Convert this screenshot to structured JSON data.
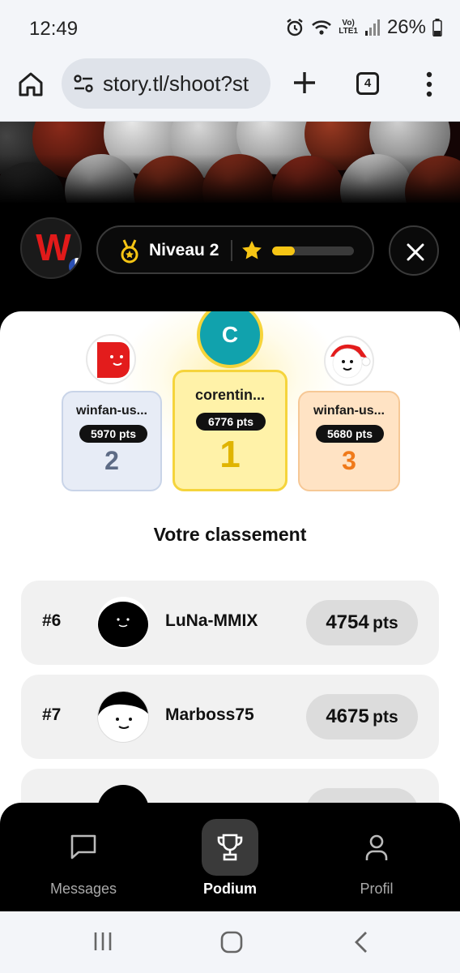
{
  "status_bar": {
    "time": "12:49",
    "network_label": "Vo)",
    "network_sub": "LTE1",
    "battery": "26%"
  },
  "browser": {
    "url": "story.tl/shoot?st",
    "tab_count": "4"
  },
  "header": {
    "level_label": "Niveau 2",
    "level_progress": 0.28,
    "brand_letter": "W"
  },
  "podium": [
    {
      "place": "2",
      "name": "winfan-us...",
      "points": "5970 pts",
      "avatar_initial": ""
    },
    {
      "place": "1",
      "name": "corentin...",
      "points": "6776 pts",
      "avatar_initial": "C"
    },
    {
      "place": "3",
      "name": "winfan-us...",
      "points": "5680 pts",
      "avatar_initial": ""
    }
  ],
  "ranking": {
    "title": "Votre classement",
    "rows": [
      {
        "position": "#6",
        "username": "LuNa-MMIX",
        "points": "4754",
        "unit": "pts"
      },
      {
        "position": "#7",
        "username": "Marboss75",
        "points": "4675",
        "unit": "pts"
      }
    ]
  },
  "nav": {
    "items": [
      {
        "label": "Messages",
        "icon": "chat-bubble-icon"
      },
      {
        "label": "Podium",
        "icon": "trophy-icon"
      },
      {
        "label": "Profil",
        "icon": "user-icon"
      }
    ]
  },
  "colors": {
    "accent_gold": "#f6c514",
    "rank1_bg": "#fff2a8",
    "rank2_bg": "#e7ecf6",
    "rank3_bg": "#ffe3c4",
    "rank2_text": "#5d6b85",
    "rank1_text": "#e0b400",
    "rank3_text": "#f07a1a"
  }
}
